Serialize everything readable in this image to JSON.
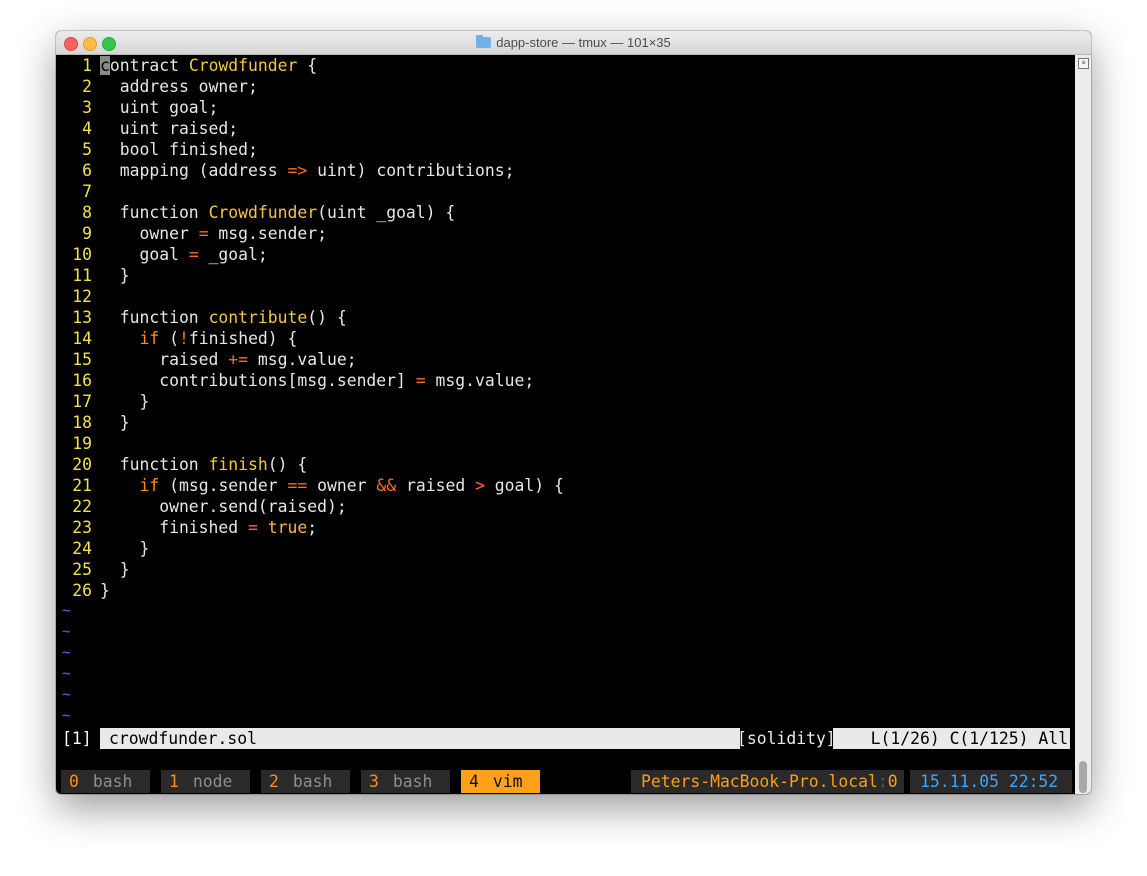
{
  "window": {
    "title": "dapp-store — tmux — 101×35",
    "folder_icon": "folder-icon"
  },
  "editor": {
    "lines": [
      {
        "n": "1",
        "code": "contract Crowdfunder {"
      },
      {
        "n": "2",
        "code": "  address owner;"
      },
      {
        "n": "3",
        "code": "  uint goal;"
      },
      {
        "n": "4",
        "code": "  uint raised;"
      },
      {
        "n": "5",
        "code": "  bool finished;"
      },
      {
        "n": "6",
        "code": "  mapping (address => uint) contributions;"
      },
      {
        "n": "7",
        "code": ""
      },
      {
        "n": "8",
        "code": "  function Crowdfunder(uint _goal) {"
      },
      {
        "n": "9",
        "code": "    owner = msg.sender;"
      },
      {
        "n": "10",
        "code": "    goal = _goal;"
      },
      {
        "n": "11",
        "code": "  }"
      },
      {
        "n": "12",
        "code": ""
      },
      {
        "n": "13",
        "code": "  function contribute() {"
      },
      {
        "n": "14",
        "code": "    if (!finished) {"
      },
      {
        "n": "15",
        "code": "      raised += msg.value;"
      },
      {
        "n": "16",
        "code": "      contributions[msg.sender] = msg.value;"
      },
      {
        "n": "17",
        "code": "    }"
      },
      {
        "n": "18",
        "code": "  }"
      },
      {
        "n": "19",
        "code": ""
      },
      {
        "n": "20",
        "code": "  function finish() {"
      },
      {
        "n": "21",
        "code": "    if (msg.sender == owner && raised > goal) {"
      },
      {
        "n": "22",
        "code": "      owner.send(raised);"
      },
      {
        "n": "23",
        "code": "      finished = true;"
      },
      {
        "n": "24",
        "code": "    }"
      },
      {
        "n": "25",
        "code": "  }"
      },
      {
        "n": "26",
        "code": "}"
      }
    ],
    "empty_marker": "~",
    "empty_count": 6
  },
  "statusline": {
    "buffer_number": "[1]",
    "filename": "crowdfunder.sol",
    "filetype": "[solidity]",
    "position": "L(1/26) C(1/125) All"
  },
  "tmux": {
    "windows": [
      {
        "index": "0",
        "name": "bash",
        "active": false
      },
      {
        "index": "1",
        "name": "node",
        "active": false
      },
      {
        "index": "2",
        "name": "bash",
        "active": false
      },
      {
        "index": "3",
        "name": "bash",
        "active": false
      },
      {
        "index": "4",
        "name": "vim",
        "active": true
      }
    ],
    "host": "Peters-MacBook-Pro.local",
    "host_sep": ":",
    "pane": "0",
    "date": "15.11.05",
    "time": "22:52"
  },
  "colors": {
    "line_number": "#f3e14c",
    "type_name": "#f5c542",
    "keyword": "#ff8c1a",
    "operator": "#ff6a2a",
    "tilde": "#5a63ff",
    "active_window_bg": "#ffa21a",
    "clock": "#3aa7ff"
  }
}
